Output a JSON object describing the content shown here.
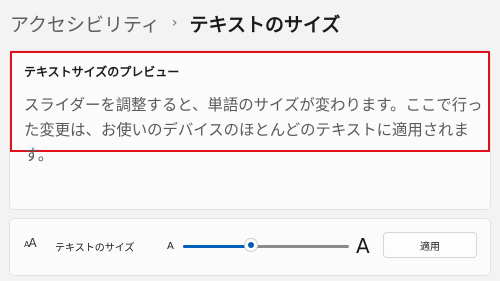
{
  "breadcrumb": {
    "parent": "アクセシビリティ",
    "separator": "›",
    "current": "テキストのサイズ"
  },
  "preview": {
    "title": "テキストサイズのプレビュー",
    "text": "スライダーを調整すると、単語のサイズが変わります。ここで行った変更は、お使いのデバイスのほとんどのテキストに適用されます。"
  },
  "setting": {
    "icon": "text-size-icon",
    "icon_glyph_small": "A",
    "icon_glyph_large": "A",
    "label": "テキストのサイズ",
    "slider_min_label": "A",
    "slider_max_label": "A",
    "slider_value_fraction": 0.41,
    "apply_label": "適用"
  },
  "colors": {
    "accent": "#005fb8",
    "highlight_border": "#e0111a",
    "background": "#f3f3f3",
    "card": "#fbfbfb"
  }
}
